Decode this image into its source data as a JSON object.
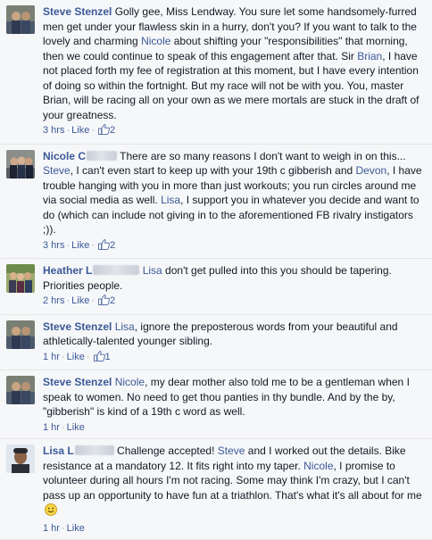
{
  "comments": [
    {
      "author": "Steve Stenzel",
      "author_rest": "",
      "segments": [
        {
          "t": "text",
          "v": "Golly gee, Miss Lendway. You sure let some handsomely-furred men get under your flawless skin in a hurry, don't you? If you want to talk to the lovely and charming "
        },
        {
          "t": "mention",
          "v": "Nicole"
        },
        {
          "t": "text",
          "v": " about shifting your \"responsibilities\" that morning, then we could continue to speak of this engagement after that. Sir "
        },
        {
          "t": "mention",
          "v": "Brian"
        },
        {
          "t": "text",
          "v": ", I have not placed forth my fee of registration at this moment, but I have every intention of doing so within the fortnight. But my race will not be with you. You, master Brian, will be racing all on your own as we mere mortals are stuck in the draft of your greatness."
        }
      ],
      "time": "3 hrs",
      "like_label": "Like",
      "likes": "2"
    },
    {
      "author": "Nicole C",
      "author_rest": "",
      "segments": [
        {
          "t": "text",
          "v": " There are so many reasons I don't want to weigh in on this... "
        },
        {
          "t": "mention",
          "v": "Steve"
        },
        {
          "t": "text",
          "v": ", I can't even start to keep up with your 19th c gibberish and "
        },
        {
          "t": "mention",
          "v": "Devon"
        },
        {
          "t": "text",
          "v": ", I have trouble hanging with you in more than just workouts; you run circles around me via social media as well. "
        },
        {
          "t": "mention",
          "v": "Lisa"
        },
        {
          "t": "text",
          "v": ", I support you in whatever you decide and want to do (which can include not giving in to the aforementioned FB rivalry instigators ;))."
        }
      ],
      "time": "3 hrs",
      "like_label": "Like",
      "likes": "2"
    },
    {
      "author": "Heather L",
      "author_rest": "",
      "segments": [
        {
          "t": "text",
          "v": " "
        },
        {
          "t": "mention",
          "v": "Lisa"
        },
        {
          "t": "text",
          "v": " don't get pulled into this you should be tapering. Priorities people."
        }
      ],
      "time": "2 hrs",
      "like_label": "Like",
      "likes": "2"
    },
    {
      "author": "Steve Stenzel",
      "author_rest": "",
      "segments": [
        {
          "t": "text",
          "v": " "
        },
        {
          "t": "mention",
          "v": "Lisa"
        },
        {
          "t": "text",
          "v": ", ignore the preposterous words from your beautiful and athletically-talented younger sibling."
        }
      ],
      "time": "1 hr",
      "like_label": "Like",
      "likes": "1"
    },
    {
      "author": "Steve Stenzel",
      "author_rest": "",
      "segments": [
        {
          "t": "text",
          "v": " "
        },
        {
          "t": "mention",
          "v": "Nicole"
        },
        {
          "t": "text",
          "v": ", my dear mother also told me to be a gentleman when I speak to women. No need to get thou panties in thy bundle. And by the by, \"gibberish\" is kind of a 19th c word as well."
        }
      ],
      "time": "1 hr",
      "like_label": "Like",
      "likes": ""
    },
    {
      "author": "Lisa L",
      "author_rest": "",
      "segments": [
        {
          "t": "text",
          "v": " Challenge accepted! "
        },
        {
          "t": "mention",
          "v": "Steve"
        },
        {
          "t": "text",
          "v": " and I worked out the details. Bike resistance at a mandatory 12. It fits right into my taper. "
        },
        {
          "t": "mention",
          "v": "Nicole"
        },
        {
          "t": "text",
          "v": ", I promise to volunteer during all hours I'm not racing. Some may think I'm crazy, but I can't pass up an opportunity to have fun at a triathlon. That's what it's all about for me "
        }
      ],
      "time": "1 hr",
      "like_label": "Like",
      "likes": "",
      "emoji": "smile-emoji"
    }
  ],
  "separator": "·",
  "colors": {
    "link": "#3b5998",
    "meta": "#9197a3",
    "text": "#141823",
    "bg": "#f6f7f9"
  }
}
